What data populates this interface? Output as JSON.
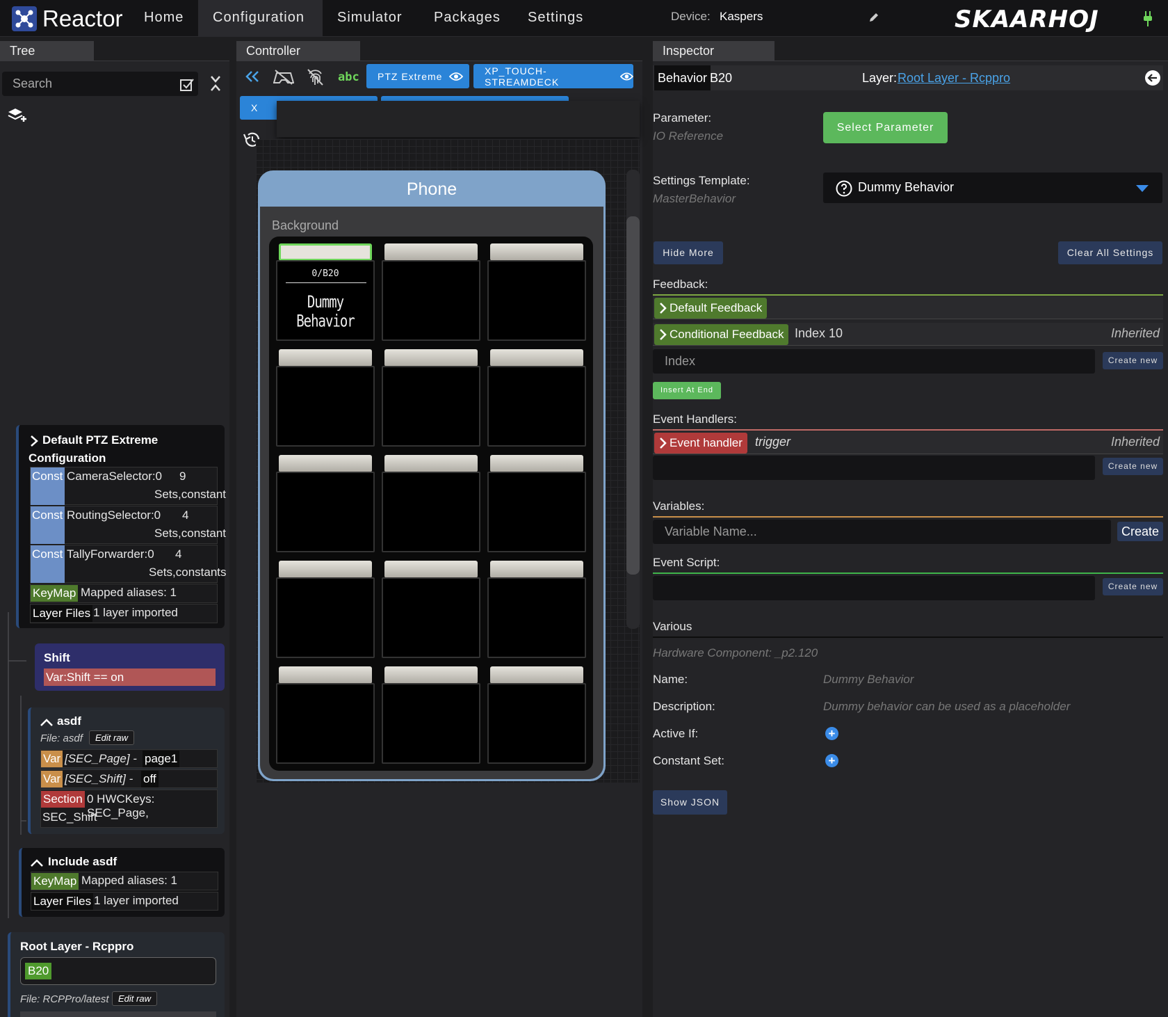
{
  "nav": {
    "app_title": "Reactor",
    "items": [
      "Home",
      "Configuration",
      "Simulator",
      "Packages",
      "Settings"
    ],
    "device_label": "Device:",
    "device_value": "Kaspers",
    "logo_text": "SKAARHOJ"
  },
  "tree": {
    "tab_label": "Tree",
    "search_placeholder": "Search",
    "default_card": {
      "title_line1": "Default PTZ Extreme",
      "title_line2": "Configuration",
      "consts": [
        {
          "tag": "Const",
          "name": "CameraSelector:0",
          "count": "9",
          "desc": "Sets,constant"
        },
        {
          "tag": "Const",
          "name": "RoutingSelector:0",
          "count": "4",
          "desc": "Sets,constant"
        },
        {
          "tag": "Const",
          "name": "TallyForwarder:0",
          "count": "4",
          "desc": "Sets,constants"
        }
      ],
      "keymap_tag": "KeyMap",
      "keymap_text": "Mapped aliases: 1",
      "layerfiles_tag": "Layer Files",
      "layerfiles_text": "1 layer imported"
    },
    "shift_card": {
      "title": "Shift",
      "condition": "Var:Shift == on"
    },
    "asdf_card": {
      "title": "asdf",
      "file": "File: asdf",
      "edit_raw": "Edit raw",
      "var1_tag": "Var",
      "var1_name": "[SEC_Page] -",
      "var1_value": "page1",
      "var2_tag": "Var",
      "var2_name": "[SEC_Shift] -",
      "var2_value": "off",
      "section_tag": "Section",
      "section_text1": "0 HWCKeys: SEC_Page,",
      "section_text2": "SEC_Shift"
    },
    "include_card": {
      "title": "Include asdf",
      "keymap_tag": "KeyMap",
      "keymap_text": "Mapped aliases: 1",
      "layerfiles_tag": "Layer Files",
      "layerfiles_text": "1 layer imported"
    },
    "root_card": {
      "title": "Root Layer - Rcppro",
      "chip": "B20",
      "file": "File: RCPPro/latest",
      "edit_raw": "Edit raw"
    }
  },
  "controller": {
    "tab_label": "Controller",
    "toolbar_text_icon": "abc",
    "device_buttons": [
      "PTZ Extreme",
      "XP_TOUCH-STREAMDECK"
    ],
    "partial_button": "X",
    "phone_title": "Phone",
    "background_label": "Background",
    "selected_key": {
      "id": "0/B20",
      "name": "Dummy Behavior"
    }
  },
  "inspector": {
    "tab_label": "Inspector",
    "behavior_tag": "Behavior",
    "behavior_id": "B20",
    "layer_label": "Layer:",
    "layer_link": "Root Layer - Rcppro",
    "parameter_label": "Parameter:",
    "parameter_sub": "IO Reference",
    "select_parameter": "Select Parameter",
    "settings_template_label": "Settings Template:",
    "settings_template_sub": "MasterBehavior",
    "settings_template_value": "Dummy Behavior",
    "hide_more": "Hide More",
    "clear_all": "Clear All Settings",
    "feedback_label": "Feedback:",
    "default_feedback": "Default Feedback",
    "conditional_feedback": "Conditional Feedback",
    "conditional_index": "Index 10",
    "inherited": "Inherited",
    "index_placeholder": "Index",
    "create_new": "Create new",
    "insert_at_end": "Insert At End",
    "event_handlers_label": "Event Handlers:",
    "event_handler": "Event handler",
    "event_trigger": "trigger",
    "variables_label": "Variables:",
    "variable_placeholder": "Variable Name...",
    "create": "Create",
    "event_script_label": "Event Script:",
    "various_label": "Various",
    "hardware_component": "Hardware Component: _p2.120",
    "name_label": "Name:",
    "name_value": "Dummy Behavior",
    "description_label": "Description:",
    "description_value": "Dummy behavior can be used as a placeholder",
    "active_if_label": "Active If:",
    "constant_set_label": "Constant Set:",
    "show_json": "Show JSON"
  },
  "colors": {
    "accent_blue": "#2b84d8",
    "green": "#5cb85c",
    "const_blue": "#6c8fc6",
    "keymap_green": "#4f7a2d",
    "var_orange": "#c98f4a",
    "section_red": "#b03a3a"
  }
}
